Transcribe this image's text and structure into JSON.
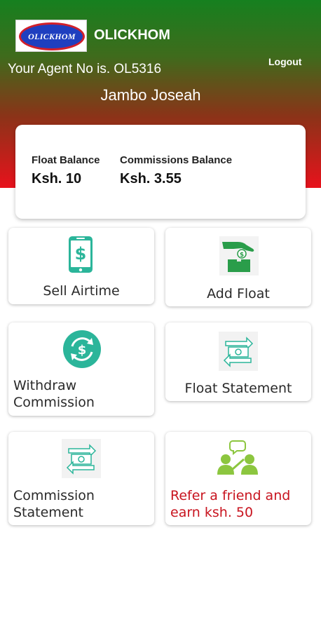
{
  "header": {
    "logo_text": "OLICKHOM",
    "app_name": "OLICKHOM",
    "logout_label": "Logout",
    "agent_no_text": "Your Agent No is. OL5316",
    "agent_name": "Jambo Joseah"
  },
  "balances": {
    "float": {
      "label": "Float Balance",
      "value": "Ksh. 10"
    },
    "commissions": {
      "label": "Commissions Balance",
      "value": "Ksh. 3.55"
    }
  },
  "tiles": {
    "sell_airtime": {
      "label": "Sell Airtime",
      "icon": "phone-dollar-icon"
    },
    "add_float": {
      "label": "Add Float",
      "icon": "hand-dropping-money-icon"
    },
    "withdraw_commission": {
      "label_line1": "Withdraw",
      "label_line2": "Commission",
      "icon": "dollar-cycle-icon"
    },
    "float_statement": {
      "label": "Float Statement",
      "icon": "money-transfer-icon"
    },
    "commission_statement": {
      "label_line1": "Commission",
      "label_line2": "Statement",
      "icon": "money-transfer-icon"
    },
    "refer_friend": {
      "label_line1": "Refer a friend and",
      "label_line2": "earn ksh. 50",
      "icon": "people-chat-icon"
    }
  },
  "colors": {
    "header_top": "#16801f",
    "header_bottom": "#e8121c",
    "refer_text": "#c8141f",
    "icon_teal": "#2bb59a",
    "icon_green": "#8cc63f"
  }
}
